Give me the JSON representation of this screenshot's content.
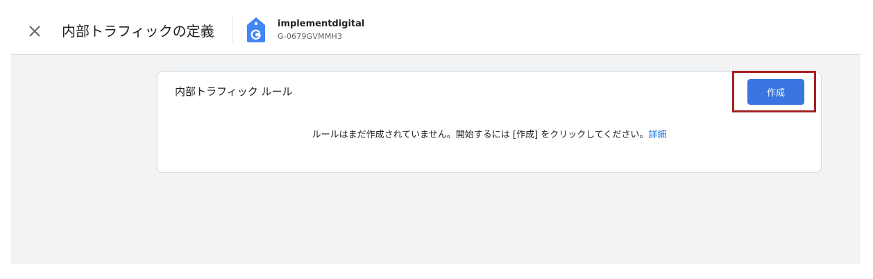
{
  "header": {
    "title": "内部トラフィックの定義",
    "property_name": "implementdigital",
    "property_id": "G-0679GVMMH3",
    "icons": {
      "close": "close-icon",
      "property": "ga-property-tag-icon"
    }
  },
  "card": {
    "title": "内部トラフィック ルール",
    "create_label": "作成",
    "empty_message": "ルールはまだ作成されていません。開始するには [作成] をクリックしてください。",
    "learn_more": "詳細"
  },
  "colors": {
    "accent": "#3a76e1",
    "link": "#1a73e8",
    "highlight": "#a32121",
    "background": "#f1f3f4",
    "property_icon": "#4285f4"
  }
}
